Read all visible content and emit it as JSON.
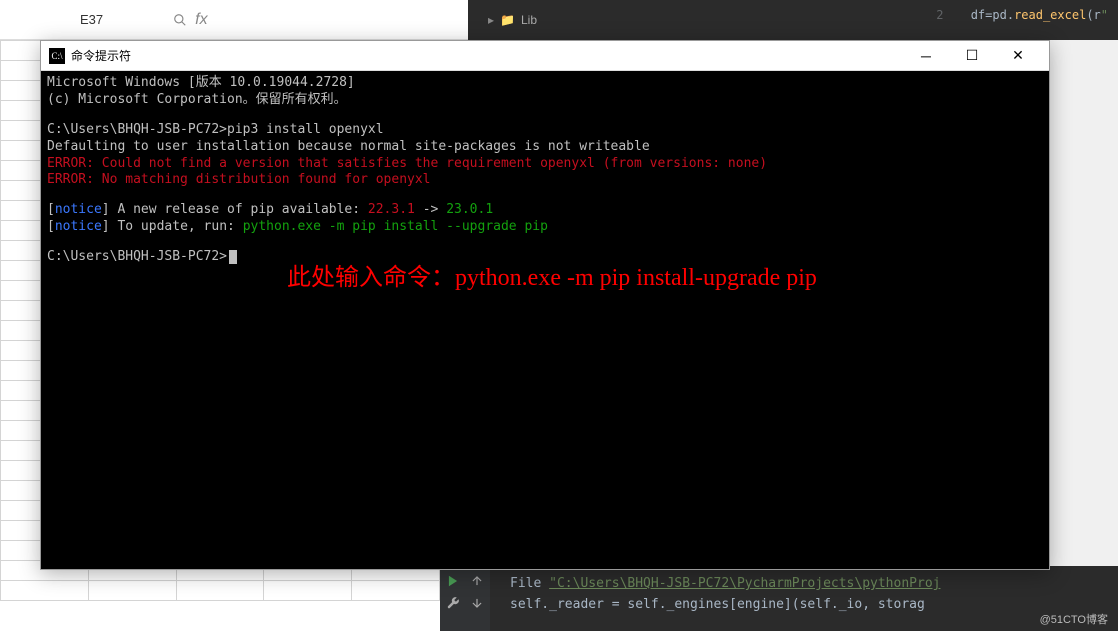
{
  "excel": {
    "cell_ref": "E37",
    "fx_label": "fx"
  },
  "ide_top": {
    "folder_label": "Lib",
    "line_num": "2",
    "code_var": "df",
    "code_eq": "=pd.",
    "code_fn": "read_excel",
    "code_paren": "(r",
    "code_str": "\""
  },
  "cmd": {
    "title": "命令提示符",
    "line1": "Microsoft Windows [版本 10.0.19044.2728]",
    "line2": "(c) Microsoft Corporation。保留所有权利。",
    "prompt1": "C:\\Users\\BHQH-JSB-PC72>",
    "cmd1": "pip3 install openyxl",
    "out1": "Defaulting to user installation because normal site-packages is not writeable",
    "err1": "ERROR: Could not find a version that satisfies the requirement openyxl (from versions: none)",
    "err2": "ERROR: No matching distribution found for openyxl",
    "notice_label": "notice",
    "notice1_a": "] A new release of pip available: ",
    "notice1_ver_old": "22.3.1",
    "notice1_arrow": " -> ",
    "notice1_ver_new": "23.0.1",
    "notice2_a": "] To update, run: ",
    "notice2_cmd": "python.exe -m pip install --upgrade pip",
    "prompt2": "C:\\Users\\BHQH-JSB-PC72>"
  },
  "annotation": "此处输入命令：python.exe -m pip install-upgrade pip",
  "ide_bottom": {
    "file_label": "File ",
    "file_path": "\"C:\\Users\\BHQH-JSB-PC72\\PycharmProjects\\pythonProj",
    "code_line": "self._reader = self._engines[engine](self._io, storag"
  },
  "watermark": "@51CTO博客"
}
